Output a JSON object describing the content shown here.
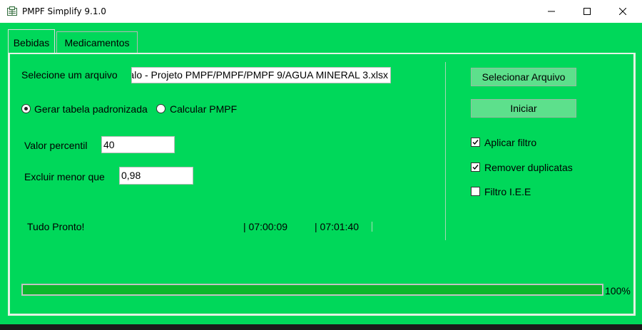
{
  "window": {
    "title": "PMPF Simplify 9.1.0",
    "icon": "app-sheet-icon",
    "controls": [
      "minimize-icon",
      "maximize-icon",
      "close-icon"
    ]
  },
  "tabs": [
    {
      "label": "Bebidas",
      "active": true
    },
    {
      "label": "Medicamentos",
      "active": false
    }
  ],
  "file": {
    "label": "Selecione um arquivo",
    "value": "alo - Projeto PMPF/PMPF/PMPF 9/AGUA MINERAL 3.xlsx"
  },
  "mode": {
    "options": [
      {
        "label": "Gerar tabela padronizada",
        "selected": true
      },
      {
        "label": "Calcular PMPF",
        "selected": false
      }
    ]
  },
  "percentil": {
    "label": "Valor percentil",
    "value": "40"
  },
  "excluir": {
    "label": "Excluir menor que",
    "value": "0,98"
  },
  "status": {
    "message": "Tudo Pronto!",
    "time_start": "| 07:00:09",
    "time_end": "| 07:01:40"
  },
  "buttons": {
    "select_file": "Selecionar Arquivo",
    "start": "Iniciar"
  },
  "options": [
    {
      "label": "Aplicar filtro",
      "checked": true
    },
    {
      "label": "Remover duplicatas",
      "checked": true
    },
    {
      "label": "Filtro I.E.E",
      "checked": false
    }
  ],
  "progress": {
    "fraction": 1.0,
    "label": "100%"
  },
  "colors": {
    "background": "#00d85a",
    "progress_fill": "#0bb82d",
    "button": "#5de08c"
  }
}
